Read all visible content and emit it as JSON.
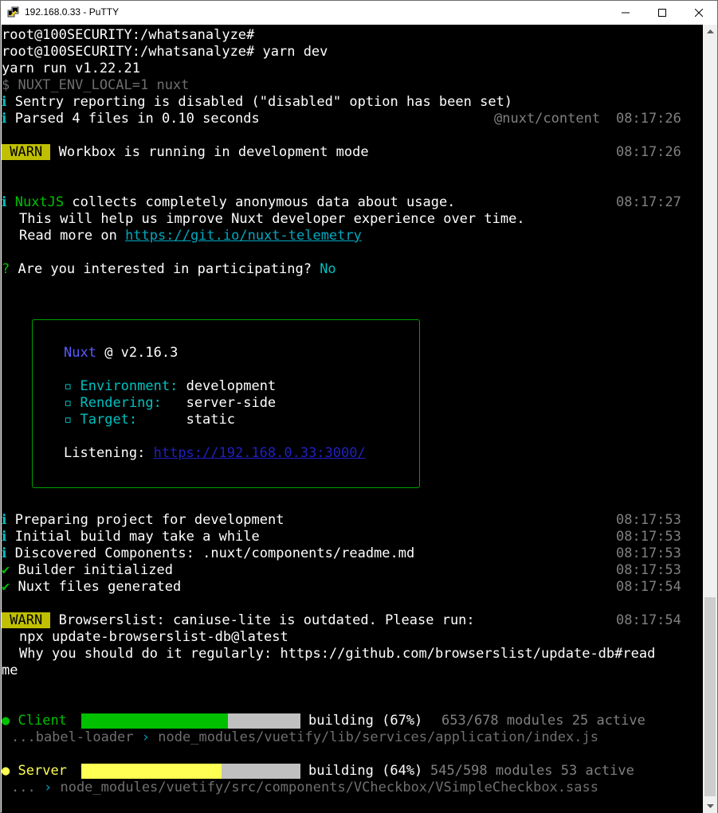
{
  "window": {
    "title": "192.168.0.33 - PuTTY"
  },
  "terminal": {
    "lines": {
      "prompt1": "root@100SECURITY:/whatsanalyze#",
      "prompt2": "root@100SECURITY:/whatsanalyze# yarn dev",
      "yarn_version": "yarn run v1.22.21",
      "nuxt_cmd": "$ NUXT_ENV_LOCAL=1 nuxt",
      "sentry": "Sentry reporting is disabled (\"disabled\" option has been set)",
      "parsed": "Parsed 4 files in 0.10 seconds",
      "parsed_source": "@nuxt/content",
      "parsed_time": "08:17:26",
      "warn_label": " WARN ",
      "workbox": "Workbox is running in development mode",
      "workbox_time": "08:17:26",
      "telemetry_brand": "NuxtJS",
      "telemetry_1": " collects completely anonymous data about usage.",
      "telemetry_time": "08:17:27",
      "telemetry_2": "This will help us improve Nuxt developer experience over time.",
      "telemetry_3": "Read more on ",
      "telemetry_link": "https://git.io/nuxt-telemetry",
      "question_mark": "?",
      "question": " Are you interested in participating?",
      "answer": " No"
    },
    "info_box": {
      "brand": "Nuxt",
      "version": " @ v2.16.3",
      "environment_label": "Environment:",
      "environment_value": "development",
      "rendering_label": "Rendering:",
      "rendering_value": "server-side",
      "target_label": "Target:",
      "target_value": "static",
      "listening_label": "Listening:",
      "listening_url": "https://192.168.0.33:3000/"
    },
    "log": [
      {
        "text": "Preparing project for development",
        "time": "08:17:53",
        "kind": "info"
      },
      {
        "text": "Initial build may take a while",
        "time": "08:17:53",
        "kind": "info"
      },
      {
        "text": "Discovered Components: .nuxt/components/readme.md",
        "time": "08:17:53",
        "kind": "info"
      },
      {
        "text": "Builder initialized",
        "time": "08:17:53",
        "kind": "success"
      },
      {
        "text": "Nuxt files generated",
        "time": "08:17:54",
        "kind": "success"
      }
    ],
    "browserslist": {
      "warn_label": " WARN ",
      "line1": "Browserslist: caniuse-lite is outdated. Please run:",
      "time": "08:17:54",
      "line2": "npx update-browserslist-db@latest",
      "line3": "Why you should do it regularly: https://github.com/browserslist/update-db#read",
      "line4": "me"
    },
    "client_build": {
      "name": "Client",
      "progress": 0.67,
      "status": "building (67%)",
      "modules": "653/678 modules 25 active",
      "loader": "...babel-loader",
      "path": "node_modules/vuetify/lib/services/application/index.js",
      "color": "#00c000"
    },
    "server_build": {
      "name": "Server",
      "progress": 0.64,
      "status": "building (64%)",
      "modules": "545/598 modules 53 active",
      "loader": "...",
      "path": "node_modules/vuetify/src/components/VCheckbox/VSimpleCheckbox.sass",
      "color": "#ffff54"
    }
  },
  "icons": {
    "info": "info-icon",
    "success": "check-icon",
    "arrow": "chevron-right-icon",
    "bullet": "bullet-icon"
  }
}
